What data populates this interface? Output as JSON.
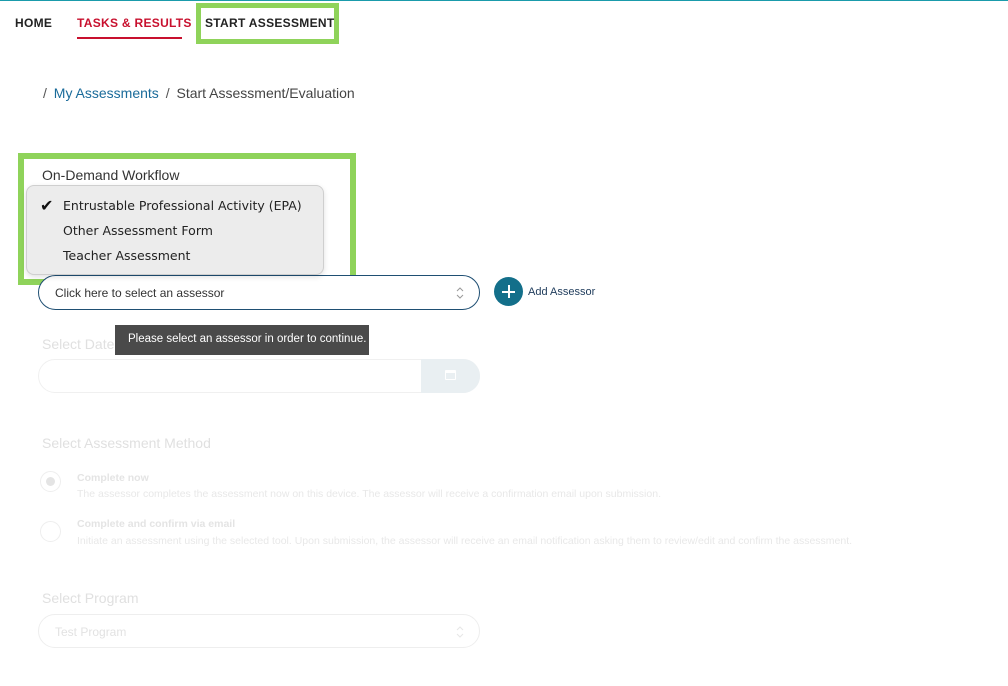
{
  "nav": {
    "items": [
      {
        "label": "HOME"
      },
      {
        "label": "TASKS & RESULTS",
        "active_color": "#c8102e"
      },
      {
        "label": "START ASSESSMENT",
        "highlighted": true
      }
    ]
  },
  "breadcrumb": {
    "separator": "/",
    "link": "My Assessments",
    "current": "Start Assessment/Evaluation"
  },
  "workflow": {
    "label": "On-Demand Workflow",
    "options": [
      {
        "label": "Entrustable Professional Activity (EPA)",
        "selected": true
      },
      {
        "label": "Other Assessment Form",
        "selected": false
      },
      {
        "label": "Teacher Assessment",
        "selected": false
      }
    ]
  },
  "assessor": {
    "placeholder": "Click here to select an assessor",
    "add_label": "Add Assessor",
    "tooltip": "Please select an assessor in order to continue."
  },
  "date": {
    "label": "Select Date of Encounter",
    "value": ""
  },
  "method": {
    "label": "Select Assessment Method",
    "options": [
      {
        "title": "Complete now",
        "description": "The assessor completes the assessment now on this device. The assessor will receive a confirmation email upon submission.",
        "selected": true
      },
      {
        "title": "Complete and confirm via email",
        "description": "Initiate an assessment using the selected tool. Upon submission, the assessor will receive an email notification asking them to review/edit and confirm the assessment.",
        "selected": false
      }
    ]
  },
  "program": {
    "label": "Select Program",
    "value": "Test Program"
  },
  "colors": {
    "accent": "#136f8a",
    "highlight": "#8fd35a",
    "active_nav": "#c8102e",
    "link": "#1a6b9a"
  }
}
